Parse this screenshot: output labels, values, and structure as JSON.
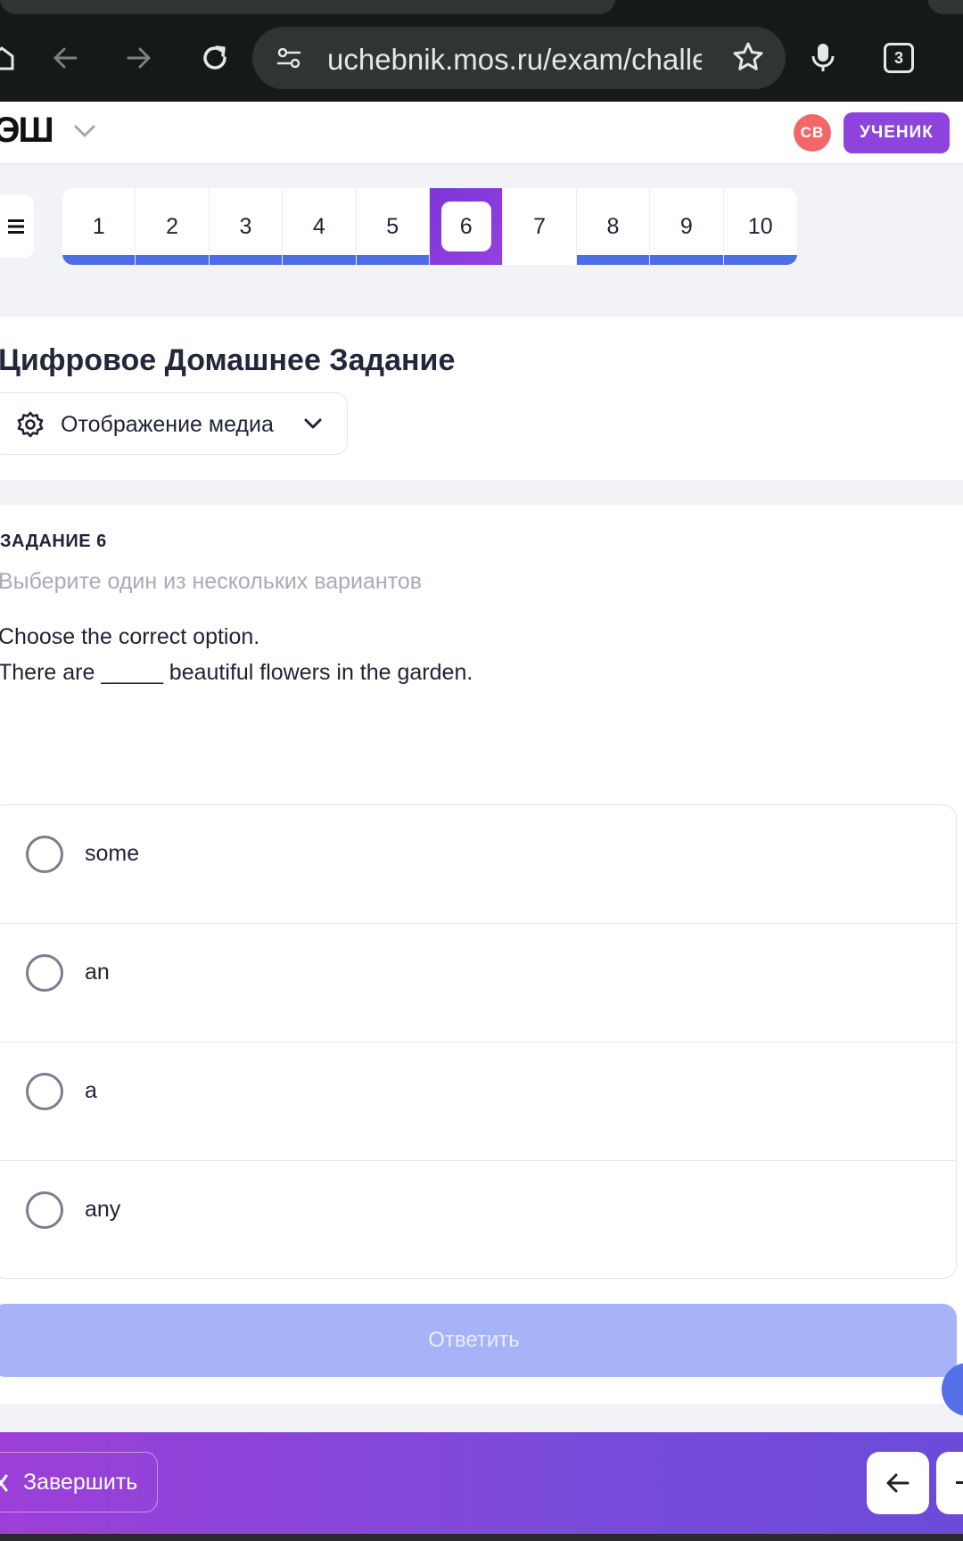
{
  "browser": {
    "url": "uchebnik.mos.ru/exam/challe",
    "tab_count": "3"
  },
  "header": {
    "logo_text": "ЭШ",
    "avatar_initials": "СВ",
    "role_label": "УЧЕНИК"
  },
  "question_nav": {
    "items": [
      {
        "label": "1",
        "status": "answered"
      },
      {
        "label": "2",
        "status": "answered"
      },
      {
        "label": "3",
        "status": "answered"
      },
      {
        "label": "4",
        "status": "answered"
      },
      {
        "label": "5",
        "status": "answered"
      },
      {
        "label": "6",
        "status": "current"
      },
      {
        "label": "7",
        "status": "unanswered"
      },
      {
        "label": "8",
        "status": "answered"
      },
      {
        "label": "9",
        "status": "answered"
      },
      {
        "label": "10",
        "status": "answered"
      }
    ]
  },
  "page": {
    "title": "Цифровое Домашнее Задание",
    "media_label": "Отображение медиа"
  },
  "task": {
    "label": "ЗАДАНИЕ 6",
    "instruction": "Выберите один из нескольких вариантов",
    "question_line1": "Choose the correct option.",
    "question_line2": "There are _____ beautiful flowers in the garden.",
    "options": [
      "some",
      "an",
      "a",
      "any"
    ],
    "submit_label": "Ответить"
  },
  "footer": {
    "finish_label": "Завершить"
  },
  "colors": {
    "accent": "#8c44dd",
    "progress": "#4d6de6",
    "submit_disabled": "#a6b4f7",
    "avatar": "#f2686a"
  }
}
